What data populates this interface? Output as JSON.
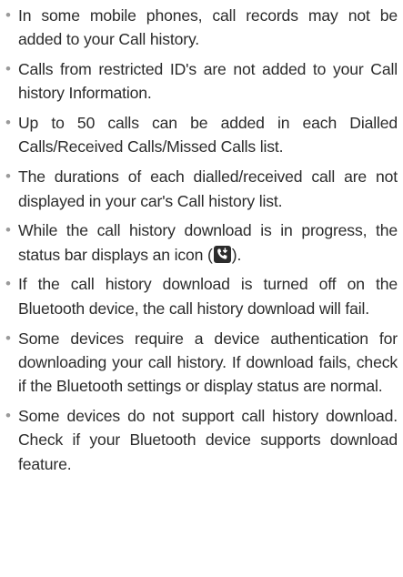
{
  "notes": [
    {
      "text": "In some mobile phones, call records may not be added to your Call history."
    },
    {
      "text": "Calls from restricted ID's are not added to your Call history Information."
    },
    {
      "text": "Up to 50 calls can be added in each Dialled Calls/Received Calls/Missed Calls list."
    },
    {
      "text": "The durations of each dialled/received call are not displayed in your car's Call history list."
    },
    {
      "text_before": "While the call history download is in progress, the status bar displays an icon (",
      "text_after": ").",
      "icon": "call-history-download-icon"
    },
    {
      "text": "If the call history download is turned off on the Bluetooth device, the call history download will fail."
    },
    {
      "text": "Some devices require a device authentication for downloading your call history. If download fails, check if the Bluetooth settings or display status are normal."
    },
    {
      "text": "Some devices do not support call history download. Check if your Bluetooth device supports download feature."
    }
  ],
  "bullet_glyph": "•"
}
